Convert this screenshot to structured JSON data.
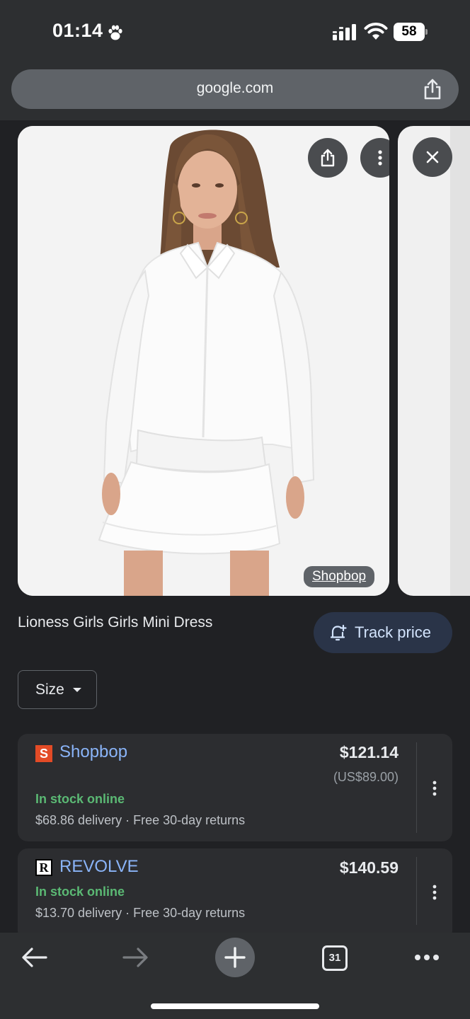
{
  "status_bar": {
    "time": "01:14",
    "battery": "58"
  },
  "browser": {
    "url": "google.com",
    "tab_count": "31"
  },
  "product": {
    "source_label": "Shopbop",
    "title": "Lioness Girls Girls Mini Dress",
    "track_price_label": "Track price",
    "size_filter_label": "Size"
  },
  "offers": [
    {
      "store": "Shopbop",
      "logo_letter": "S",
      "price": "$121.14",
      "original_price": "(US$89.00)",
      "stock": "In stock online",
      "delivery": "$68.86 delivery · Free 30-day returns"
    },
    {
      "store": "REVOLVE",
      "logo_letter": "R",
      "price": "$140.59",
      "stock": "In stock online",
      "delivery": "$13.70 delivery · Free 30-day returns"
    }
  ],
  "colors": {
    "background": "#202124",
    "link": "#8ab4f8",
    "in_stock": "#5bb974",
    "shopbop_logo": "#e34b26"
  },
  "icons": [
    "paw-icon",
    "signal-icon",
    "wifi-icon",
    "share-icon",
    "more-vert-icon",
    "close-icon",
    "price-alert-icon",
    "caret-down-icon",
    "back-icon",
    "forward-icon",
    "new-tab-icon",
    "tab-switcher-icon",
    "more-horiz-icon"
  ]
}
